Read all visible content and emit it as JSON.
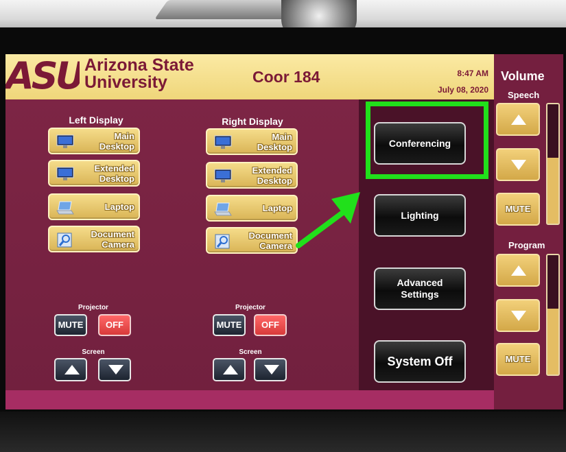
{
  "header": {
    "logo_text": "ASU",
    "university_line1": "Arizona State",
    "university_line2": "University",
    "room": "Coor 184",
    "time": "8:47 AM",
    "date": "July 08, 2020"
  },
  "left_display": {
    "title": "Left Display",
    "sources": [
      {
        "line1": "Main",
        "line2": "Desktop",
        "icon": "monitor-icon"
      },
      {
        "line1": "Extended",
        "line2": "Desktop",
        "icon": "monitor-icon"
      },
      {
        "line1": "Laptop",
        "line2": "",
        "icon": "laptop-icon"
      },
      {
        "line1": "Document",
        "line2": "Camera",
        "icon": "document-camera-icon"
      }
    ],
    "projector_label": "Projector",
    "mute_label": "MUTE",
    "off_label": "OFF",
    "screen_label": "Screen"
  },
  "right_display": {
    "title": "Right Display",
    "sources": [
      {
        "line1": "Main",
        "line2": "Desktop",
        "icon": "monitor-icon"
      },
      {
        "line1": "Extended",
        "line2": "Desktop",
        "icon": "monitor-icon"
      },
      {
        "line1": "Laptop",
        "line2": "",
        "icon": "laptop-icon"
      },
      {
        "line1": "Document",
        "line2": "Camera",
        "icon": "document-camera-icon"
      }
    ],
    "projector_label": "Projector",
    "mute_label": "MUTE",
    "off_label": "OFF",
    "screen_label": "Screen"
  },
  "actions": {
    "conferencing": "Conferencing",
    "lighting": "Lighting",
    "advanced_line1": "Advanced",
    "advanced_line2": "Settings",
    "system_off": "System Off"
  },
  "volume": {
    "title": "Volume",
    "speech": {
      "label": "Speech",
      "mute": "MUTE",
      "level": 0.55
    },
    "program": {
      "label": "Program",
      "mute": "MUTE",
      "level": 0.55
    }
  },
  "colors": {
    "maroon": "#741f3f",
    "gold": "#efd67a",
    "highlight_green": "#21e01b",
    "off_red": "#e04646"
  }
}
